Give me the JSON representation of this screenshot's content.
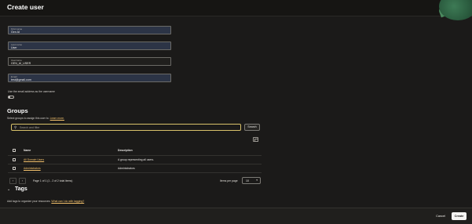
{
  "header": {
    "title": "Create user"
  },
  "form": {
    "first_name": {
      "label": "First name",
      "value": "Gen AI"
    },
    "last_name": {
      "label": "Last name",
      "value": "User"
    },
    "username": {
      "label": "Username",
      "value": "GEN_AI_USER"
    },
    "email": {
      "label": "Email",
      "value": "test@gmail.com"
    },
    "toggle_label": "Use the email address as the username"
  },
  "groups": {
    "title": "Groups",
    "description": "Select groups to assign this user to.",
    "learn_more": "Learn more.",
    "search_placeholder": "Search and filter",
    "search_button": "Search",
    "columns": {
      "name": "Name",
      "description": "Description"
    },
    "rows": [
      {
        "name": "All Domain Users",
        "description": "A group representing all users."
      },
      {
        "name": "Administrators",
        "description": "Administrators"
      }
    ],
    "pager": {
      "info": "Page 1 of 1 (1 - 2 of 2 total items)",
      "items_per_page_label": "Items per page",
      "items_per_page": "10"
    }
  },
  "tags": {
    "title": "Tags",
    "description": "Add tags to organize your resources.",
    "link": "What can I do with tagging?"
  },
  "footer": {
    "cancel": "Cancel",
    "create": "Create"
  },
  "colors": {
    "accent_link": "#f2c06b",
    "primary_button": "#f5f4f2",
    "filled_field": "#2c3446"
  }
}
